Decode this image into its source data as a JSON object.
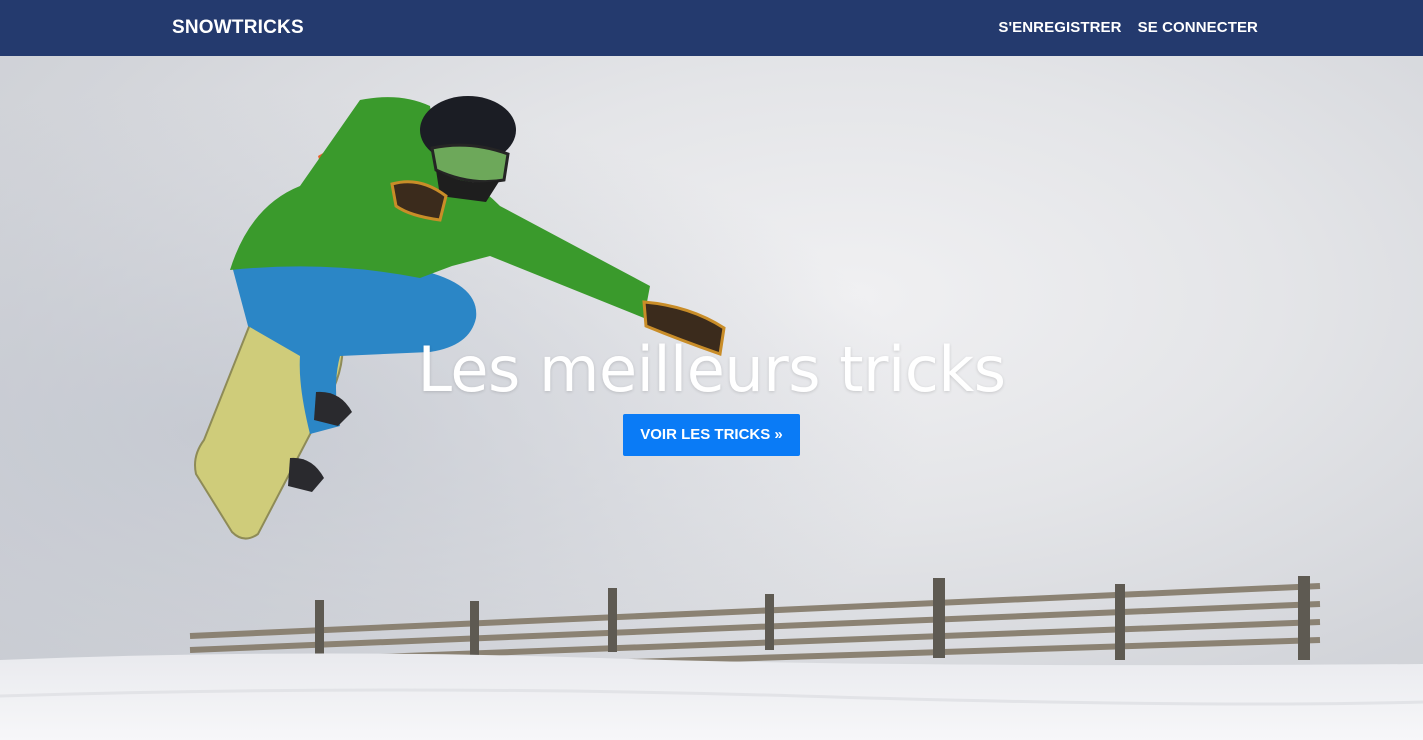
{
  "navbar": {
    "brand": "SNOWTRICKS",
    "links": [
      {
        "label": "S'ENREGISTRER"
      },
      {
        "label": "SE CONNECTER"
      }
    ],
    "background_color": "#243a6e"
  },
  "hero": {
    "title": "Les meilleurs tricks",
    "cta_label": "VOIR LES TRICKS »",
    "cta_color": "#0a7bf6",
    "image": "snowboarder-jump-photo"
  }
}
